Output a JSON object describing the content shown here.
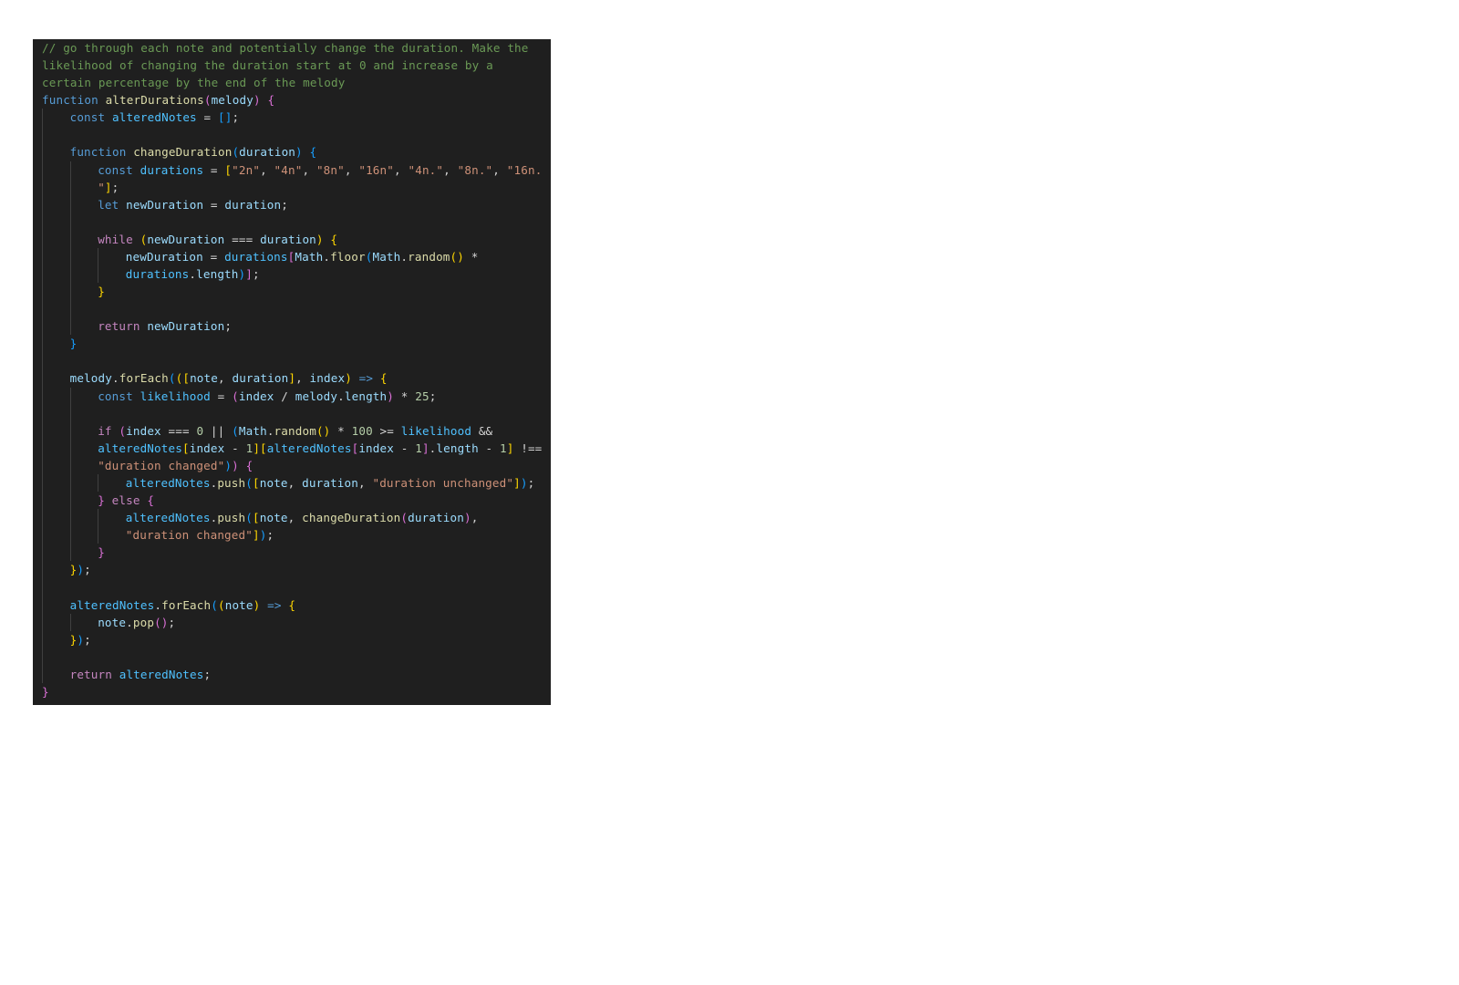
{
  "editor": {
    "language": "javascript",
    "theme_colors": {
      "background": "#1f1f1f",
      "comment": "#6a9955",
      "keyword": "#569cd6",
      "control": "#c586c0",
      "function": "#dcdcaa",
      "parameter": "#9cdcfe",
      "variable": "#4fc1ff",
      "string": "#ce9178",
      "number": "#b5cea8",
      "operator": "#d4d4d4",
      "bracket_1": "#ffd700",
      "bracket_2": "#da70d6",
      "bracket_3": "#179fff"
    },
    "lines": [
      {
        "indent": 0,
        "tokens": [
          {
            "c": "comment",
            "t": "// go through each note and potentially change the duration. Make the"
          }
        ]
      },
      {
        "indent": 0,
        "tokens": [
          {
            "c": "comment",
            "t": "likelihood of changing the duration start at 0 and increase by a"
          }
        ]
      },
      {
        "indent": 0,
        "tokens": [
          {
            "c": "comment",
            "t": "certain percentage by the end of the melody"
          }
        ]
      },
      {
        "indent": 0,
        "tokens": [
          {
            "c": "kw",
            "t": "function "
          },
          {
            "c": "fn",
            "t": "alterDurations"
          },
          {
            "c": "b2",
            "t": "("
          },
          {
            "c": "param",
            "t": "melody"
          },
          {
            "c": "b2",
            "t": ")"
          },
          {
            "c": "op",
            "t": " "
          },
          {
            "c": "b2",
            "t": "{"
          }
        ]
      },
      {
        "indent": 1,
        "tokens": [
          {
            "c": "kw",
            "t": "const "
          },
          {
            "c": "var",
            "t": "alteredNotes"
          },
          {
            "c": "op",
            "t": " = "
          },
          {
            "c": "b3",
            "t": "[]"
          },
          {
            "c": "op",
            "t": ";"
          }
        ]
      },
      {
        "indent": 1,
        "tokens": []
      },
      {
        "indent": 1,
        "tokens": [
          {
            "c": "kw",
            "t": "function "
          },
          {
            "c": "fn",
            "t": "changeDuration"
          },
          {
            "c": "b3",
            "t": "("
          },
          {
            "c": "param",
            "t": "duration"
          },
          {
            "c": "b3",
            "t": ")"
          },
          {
            "c": "op",
            "t": " "
          },
          {
            "c": "b3",
            "t": "{"
          }
        ]
      },
      {
        "indent": 2,
        "tokens": [
          {
            "c": "kw",
            "t": "const "
          },
          {
            "c": "var",
            "t": "durations"
          },
          {
            "c": "op",
            "t": " = "
          },
          {
            "c": "b1",
            "t": "["
          },
          {
            "c": "str",
            "t": "\"2n\""
          },
          {
            "c": "op",
            "t": ", "
          },
          {
            "c": "str",
            "t": "\"4n\""
          },
          {
            "c": "op",
            "t": ", "
          },
          {
            "c": "str",
            "t": "\"8n\""
          },
          {
            "c": "op",
            "t": ", "
          },
          {
            "c": "str",
            "t": "\"16n\""
          },
          {
            "c": "op",
            "t": ", "
          },
          {
            "c": "str",
            "t": "\"4n.\""
          },
          {
            "c": "op",
            "t": ", "
          },
          {
            "c": "str",
            "t": "\"8n.\""
          },
          {
            "c": "op",
            "t": ", "
          },
          {
            "c": "str",
            "t": "\"16n."
          }
        ]
      },
      {
        "indent": 2,
        "tokens": [
          {
            "c": "str",
            "t": "\""
          },
          {
            "c": "b1",
            "t": "]"
          },
          {
            "c": "op",
            "t": ";"
          }
        ]
      },
      {
        "indent": 2,
        "tokens": [
          {
            "c": "kw",
            "t": "let "
          },
          {
            "c": "param",
            "t": "newDuration"
          },
          {
            "c": "op",
            "t": " = "
          },
          {
            "c": "param",
            "t": "duration"
          },
          {
            "c": "op",
            "t": ";"
          }
        ]
      },
      {
        "indent": 2,
        "tokens": []
      },
      {
        "indent": 2,
        "tokens": [
          {
            "c": "ctrl",
            "t": "while "
          },
          {
            "c": "b1",
            "t": "("
          },
          {
            "c": "param",
            "t": "newDuration"
          },
          {
            "c": "op",
            "t": " === "
          },
          {
            "c": "param",
            "t": "duration"
          },
          {
            "c": "b1",
            "t": ")"
          },
          {
            "c": "op",
            "t": " "
          },
          {
            "c": "b1",
            "t": "{"
          }
        ]
      },
      {
        "indent": 3,
        "tokens": [
          {
            "c": "param",
            "t": "newDuration"
          },
          {
            "c": "op",
            "t": " = "
          },
          {
            "c": "var",
            "t": "durations"
          },
          {
            "c": "b2",
            "t": "["
          },
          {
            "c": "param",
            "t": "Math"
          },
          {
            "c": "op",
            "t": "."
          },
          {
            "c": "fn",
            "t": "floor"
          },
          {
            "c": "b3",
            "t": "("
          },
          {
            "c": "param",
            "t": "Math"
          },
          {
            "c": "op",
            "t": "."
          },
          {
            "c": "fn",
            "t": "random"
          },
          {
            "c": "b1",
            "t": "()"
          },
          {
            "c": "op",
            "t": " *"
          }
        ]
      },
      {
        "indent": 3,
        "tokens": [
          {
            "c": "var",
            "t": "durations"
          },
          {
            "c": "op",
            "t": "."
          },
          {
            "c": "param",
            "t": "length"
          },
          {
            "c": "b3",
            "t": ")"
          },
          {
            "c": "b2",
            "t": "]"
          },
          {
            "c": "op",
            "t": ";"
          }
        ]
      },
      {
        "indent": 2,
        "tokens": [
          {
            "c": "b1",
            "t": "}"
          }
        ]
      },
      {
        "indent": 2,
        "tokens": []
      },
      {
        "indent": 2,
        "tokens": [
          {
            "c": "ctrl",
            "t": "return "
          },
          {
            "c": "param",
            "t": "newDuration"
          },
          {
            "c": "op",
            "t": ";"
          }
        ]
      },
      {
        "indent": 1,
        "tokens": [
          {
            "c": "b3",
            "t": "}"
          }
        ]
      },
      {
        "indent": 1,
        "tokens": []
      },
      {
        "indent": 1,
        "tokens": [
          {
            "c": "param",
            "t": "melody"
          },
          {
            "c": "op",
            "t": "."
          },
          {
            "c": "fn",
            "t": "forEach"
          },
          {
            "c": "b3",
            "t": "("
          },
          {
            "c": "b1",
            "t": "(["
          },
          {
            "c": "param",
            "t": "note"
          },
          {
            "c": "op",
            "t": ", "
          },
          {
            "c": "param",
            "t": "duration"
          },
          {
            "c": "b1",
            "t": "]"
          },
          {
            "c": "op",
            "t": ", "
          },
          {
            "c": "param",
            "t": "index"
          },
          {
            "c": "b1",
            "t": ")"
          },
          {
            "c": "op",
            "t": " "
          },
          {
            "c": "kw",
            "t": "=>"
          },
          {
            "c": "op",
            "t": " "
          },
          {
            "c": "b1",
            "t": "{"
          }
        ]
      },
      {
        "indent": 2,
        "tokens": [
          {
            "c": "kw",
            "t": "const "
          },
          {
            "c": "var",
            "t": "likelihood"
          },
          {
            "c": "op",
            "t": " = "
          },
          {
            "c": "b2",
            "t": "("
          },
          {
            "c": "param",
            "t": "index"
          },
          {
            "c": "op",
            "t": " / "
          },
          {
            "c": "param",
            "t": "melody"
          },
          {
            "c": "op",
            "t": "."
          },
          {
            "c": "param",
            "t": "length"
          },
          {
            "c": "b2",
            "t": ")"
          },
          {
            "c": "op",
            "t": " * "
          },
          {
            "c": "num",
            "t": "25"
          },
          {
            "c": "op",
            "t": ";"
          }
        ]
      },
      {
        "indent": 2,
        "tokens": []
      },
      {
        "indent": 2,
        "tokens": [
          {
            "c": "ctrl",
            "t": "if "
          },
          {
            "c": "b2",
            "t": "("
          },
          {
            "c": "param",
            "t": "index"
          },
          {
            "c": "op",
            "t": " === "
          },
          {
            "c": "num",
            "t": "0"
          },
          {
            "c": "op",
            "t": " || "
          },
          {
            "c": "b3",
            "t": "("
          },
          {
            "c": "param",
            "t": "Math"
          },
          {
            "c": "op",
            "t": "."
          },
          {
            "c": "fn",
            "t": "random"
          },
          {
            "c": "b1",
            "t": "()"
          },
          {
            "c": "op",
            "t": " * "
          },
          {
            "c": "num",
            "t": "100"
          },
          {
            "c": "op",
            "t": " >= "
          },
          {
            "c": "var",
            "t": "likelihood"
          },
          {
            "c": "op",
            "t": " &&"
          }
        ]
      },
      {
        "indent": 2,
        "tokens": [
          {
            "c": "var",
            "t": "alteredNotes"
          },
          {
            "c": "b1",
            "t": "["
          },
          {
            "c": "param",
            "t": "index"
          },
          {
            "c": "op",
            "t": " - "
          },
          {
            "c": "num",
            "t": "1"
          },
          {
            "c": "b1",
            "t": "]["
          },
          {
            "c": "var",
            "t": "alteredNotes"
          },
          {
            "c": "b2",
            "t": "["
          },
          {
            "c": "param",
            "t": "index"
          },
          {
            "c": "op",
            "t": " - "
          },
          {
            "c": "num",
            "t": "1"
          },
          {
            "c": "b2",
            "t": "]"
          },
          {
            "c": "op",
            "t": "."
          },
          {
            "c": "param",
            "t": "length"
          },
          {
            "c": "op",
            "t": " - "
          },
          {
            "c": "num",
            "t": "1"
          },
          {
            "c": "b1",
            "t": "]"
          },
          {
            "c": "op",
            "t": " !=="
          }
        ]
      },
      {
        "indent": 2,
        "tokens": [
          {
            "c": "str",
            "t": "\"duration changed\""
          },
          {
            "c": "b3",
            "t": ")"
          },
          {
            "c": "b2",
            "t": ")"
          },
          {
            "c": "op",
            "t": " "
          },
          {
            "c": "b2",
            "t": "{"
          }
        ]
      },
      {
        "indent": 3,
        "tokens": [
          {
            "c": "var",
            "t": "alteredNotes"
          },
          {
            "c": "op",
            "t": "."
          },
          {
            "c": "fn",
            "t": "push"
          },
          {
            "c": "b3",
            "t": "("
          },
          {
            "c": "b1",
            "t": "["
          },
          {
            "c": "param",
            "t": "note"
          },
          {
            "c": "op",
            "t": ", "
          },
          {
            "c": "param",
            "t": "duration"
          },
          {
            "c": "op",
            "t": ", "
          },
          {
            "c": "str",
            "t": "\"duration unchanged\""
          },
          {
            "c": "b1",
            "t": "]"
          },
          {
            "c": "b3",
            "t": ")"
          },
          {
            "c": "op",
            "t": ";"
          }
        ]
      },
      {
        "indent": 2,
        "tokens": [
          {
            "c": "b2",
            "t": "}"
          },
          {
            "c": "op",
            "t": " "
          },
          {
            "c": "ctrl",
            "t": "else "
          },
          {
            "c": "b2",
            "t": "{"
          }
        ]
      },
      {
        "indent": 3,
        "tokens": [
          {
            "c": "var",
            "t": "alteredNotes"
          },
          {
            "c": "op",
            "t": "."
          },
          {
            "c": "fn",
            "t": "push"
          },
          {
            "c": "b3",
            "t": "("
          },
          {
            "c": "b1",
            "t": "["
          },
          {
            "c": "param",
            "t": "note"
          },
          {
            "c": "op",
            "t": ", "
          },
          {
            "c": "fn",
            "t": "changeDuration"
          },
          {
            "c": "b2",
            "t": "("
          },
          {
            "c": "param",
            "t": "duration"
          },
          {
            "c": "b2",
            "t": ")"
          },
          {
            "c": "op",
            "t": ","
          }
        ]
      },
      {
        "indent": 3,
        "tokens": [
          {
            "c": "str",
            "t": "\"duration changed\""
          },
          {
            "c": "b1",
            "t": "]"
          },
          {
            "c": "b3",
            "t": ")"
          },
          {
            "c": "op",
            "t": ";"
          }
        ]
      },
      {
        "indent": 2,
        "tokens": [
          {
            "c": "b2",
            "t": "}"
          }
        ]
      },
      {
        "indent": 1,
        "tokens": [
          {
            "c": "b1",
            "t": "}"
          },
          {
            "c": "b3",
            "t": ")"
          },
          {
            "c": "op",
            "t": ";"
          }
        ]
      },
      {
        "indent": 1,
        "tokens": []
      },
      {
        "indent": 1,
        "tokens": [
          {
            "c": "var",
            "t": "alteredNotes"
          },
          {
            "c": "op",
            "t": "."
          },
          {
            "c": "fn",
            "t": "forEach"
          },
          {
            "c": "b3",
            "t": "("
          },
          {
            "c": "b1",
            "t": "("
          },
          {
            "c": "param",
            "t": "note"
          },
          {
            "c": "b1",
            "t": ")"
          },
          {
            "c": "op",
            "t": " "
          },
          {
            "c": "kw",
            "t": "=>"
          },
          {
            "c": "op",
            "t": " "
          },
          {
            "c": "b1",
            "t": "{"
          }
        ]
      },
      {
        "indent": 2,
        "tokens": [
          {
            "c": "param",
            "t": "note"
          },
          {
            "c": "op",
            "t": "."
          },
          {
            "c": "fn",
            "t": "pop"
          },
          {
            "c": "b2",
            "t": "()"
          },
          {
            "c": "op",
            "t": ";"
          }
        ]
      },
      {
        "indent": 1,
        "tokens": [
          {
            "c": "b1",
            "t": "}"
          },
          {
            "c": "b3",
            "t": ")"
          },
          {
            "c": "op",
            "t": ";"
          }
        ]
      },
      {
        "indent": 1,
        "tokens": []
      },
      {
        "indent": 1,
        "tokens": [
          {
            "c": "ctrl",
            "t": "return "
          },
          {
            "c": "var",
            "t": "alteredNotes"
          },
          {
            "c": "op",
            "t": ";"
          }
        ]
      },
      {
        "indent": 0,
        "tokens": [
          {
            "c": "b2",
            "t": "}"
          }
        ]
      }
    ]
  }
}
